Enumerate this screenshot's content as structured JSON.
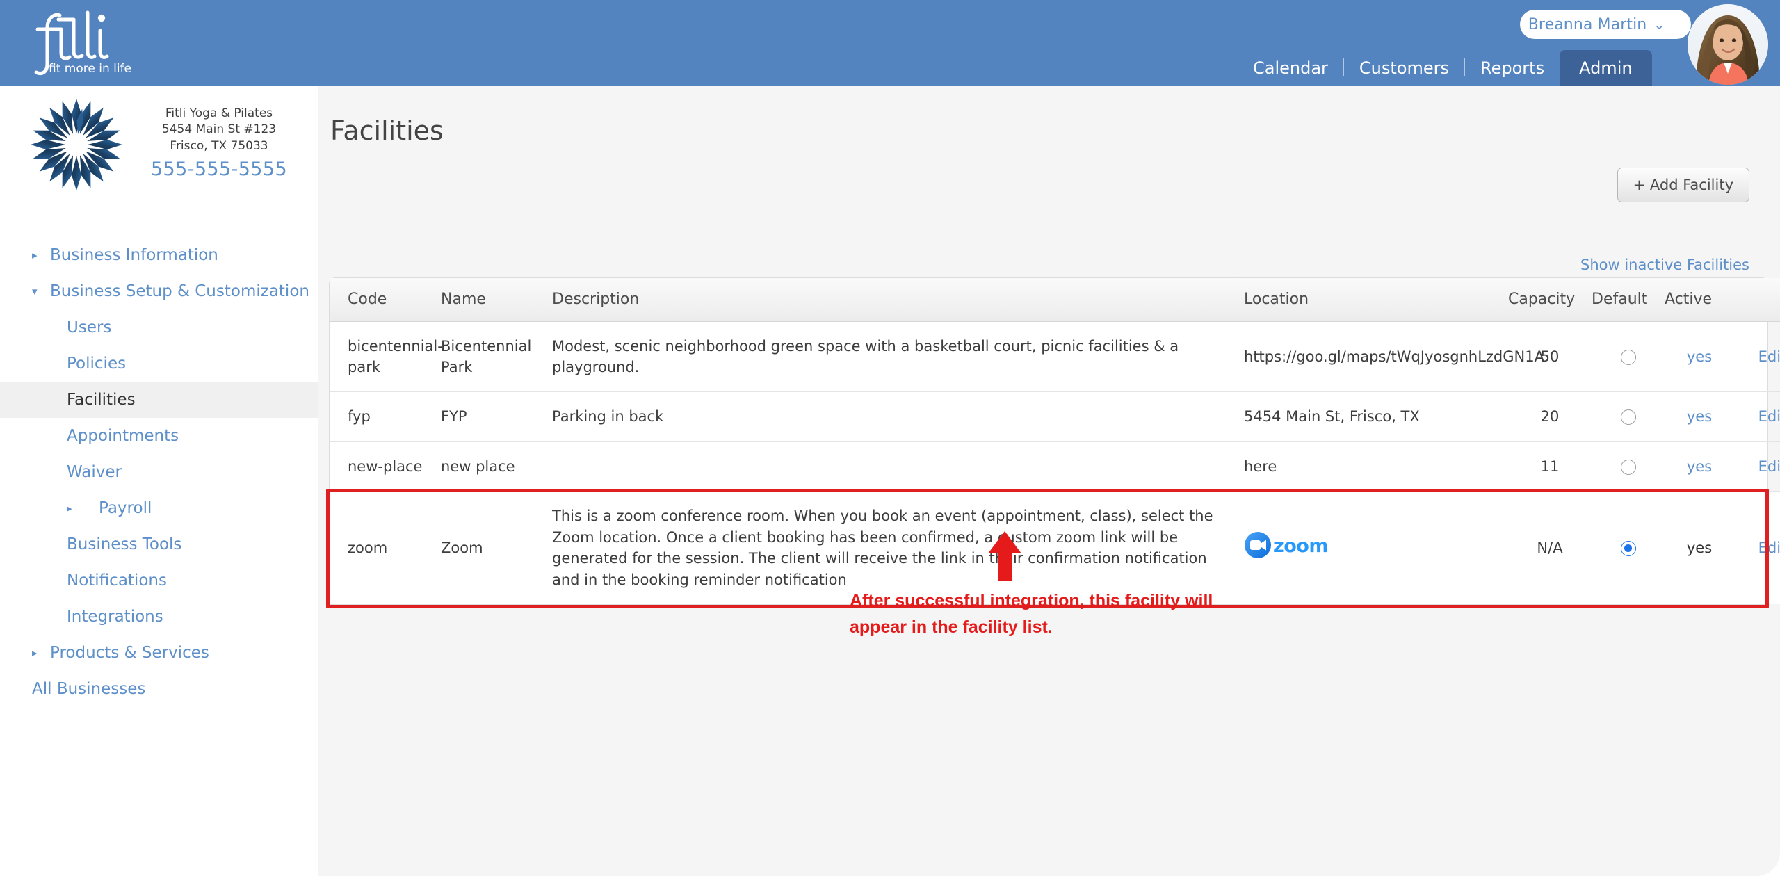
{
  "brand": {
    "logo_text": "fitli",
    "logo_tagline": "fit more in life",
    "header_color": "#5484bf",
    "active_tab_color": "#3c6298",
    "link_color": "#5d8fc9",
    "annotation_color": "#e51b1b"
  },
  "header": {
    "user_name": "Breanna Martin",
    "user_chevron": "chevron-down",
    "nav": [
      {
        "label": "Calendar",
        "active": false
      },
      {
        "label": "Customers",
        "active": false
      },
      {
        "label": "Reports",
        "active": false
      },
      {
        "label": "Admin",
        "active": true
      }
    ]
  },
  "business": {
    "name": "Fitli Yoga & Pilates",
    "address_line1": "5454 Main St #123",
    "address_line2": "Frisco, TX 75033",
    "phone": "555-555-5555"
  },
  "sidebar": {
    "items": [
      {
        "label": "Business Information",
        "level": 0,
        "caret": "right",
        "selected": false
      },
      {
        "label": "Business Setup & Customization",
        "level": 0,
        "caret": "down",
        "selected": false
      },
      {
        "label": "Users",
        "level": 1,
        "caret": "",
        "selected": false
      },
      {
        "label": "Policies",
        "level": 1,
        "caret": "",
        "selected": false
      },
      {
        "label": "Facilities",
        "level": 1,
        "caret": "",
        "selected": true
      },
      {
        "label": "Appointments",
        "level": 1,
        "caret": "",
        "selected": false
      },
      {
        "label": "Waiver",
        "level": 1,
        "caret": "",
        "selected": false
      },
      {
        "label": "Payroll",
        "level": 2,
        "caret": "right",
        "selected": false
      },
      {
        "label": "Business Tools",
        "level": 1,
        "caret": "",
        "selected": false
      },
      {
        "label": "Notifications",
        "level": 1,
        "caret": "",
        "selected": false
      },
      {
        "label": "Integrations",
        "level": 1,
        "caret": "",
        "selected": false
      },
      {
        "label": "Products & Services",
        "level": 0,
        "caret": "right",
        "selected": false
      },
      {
        "label": "All Businesses",
        "level": 0,
        "caret": "",
        "selected": false
      }
    ]
  },
  "main": {
    "title": "Facilities",
    "add_button": "+ Add Facility",
    "show_inactive_link": "Show inactive Facilities",
    "table": {
      "columns": [
        "Code",
        "Name",
        "Description",
        "Location",
        "Capacity",
        "Default",
        "Active",
        ""
      ],
      "rows": [
        {
          "code": "bicentennial-park",
          "name": "Bicentennial Park",
          "description": "Modest, scenic neighborhood green space with a basketball court, picnic facilities & a playground.",
          "location": "https://goo.gl/maps/tWqJyosgnhLzdGN1A",
          "location_is_logo": false,
          "capacity": "50",
          "default_selected": false,
          "active": "yes",
          "active_is_link": true,
          "edit": "Edit",
          "highlighted": false
        },
        {
          "code": "fyp",
          "name": "FYP",
          "description": "Parking in back",
          "location": "5454 Main St, Frisco, TX",
          "location_is_logo": false,
          "capacity": "20",
          "default_selected": false,
          "active": "yes",
          "active_is_link": true,
          "edit": "Edit",
          "highlighted": false
        },
        {
          "code": "new-place",
          "name": "new place",
          "description": "",
          "location": "here",
          "location_is_logo": false,
          "capacity": "11",
          "default_selected": false,
          "active": "yes",
          "active_is_link": true,
          "edit": "Edit",
          "highlighted": false
        },
        {
          "code": "zoom",
          "name": "Zoom",
          "description": "This is a zoom conference room. When you book an event (appointment, class), select the Zoom location. Once a client booking has been confirmed, a custom zoom link will be generated for the session. The client will receive the link in their confirmation notification and in the booking reminder notification",
          "location": "zoom-logo",
          "location_is_logo": true,
          "capacity": "N/A",
          "default_selected": true,
          "active": "yes",
          "active_is_link": false,
          "edit": "Edit",
          "highlighted": true
        }
      ]
    }
  },
  "annotation": {
    "text": "After successful integration, this facility will\nappear in the facility list.",
    "arrow": "up-arrow"
  }
}
